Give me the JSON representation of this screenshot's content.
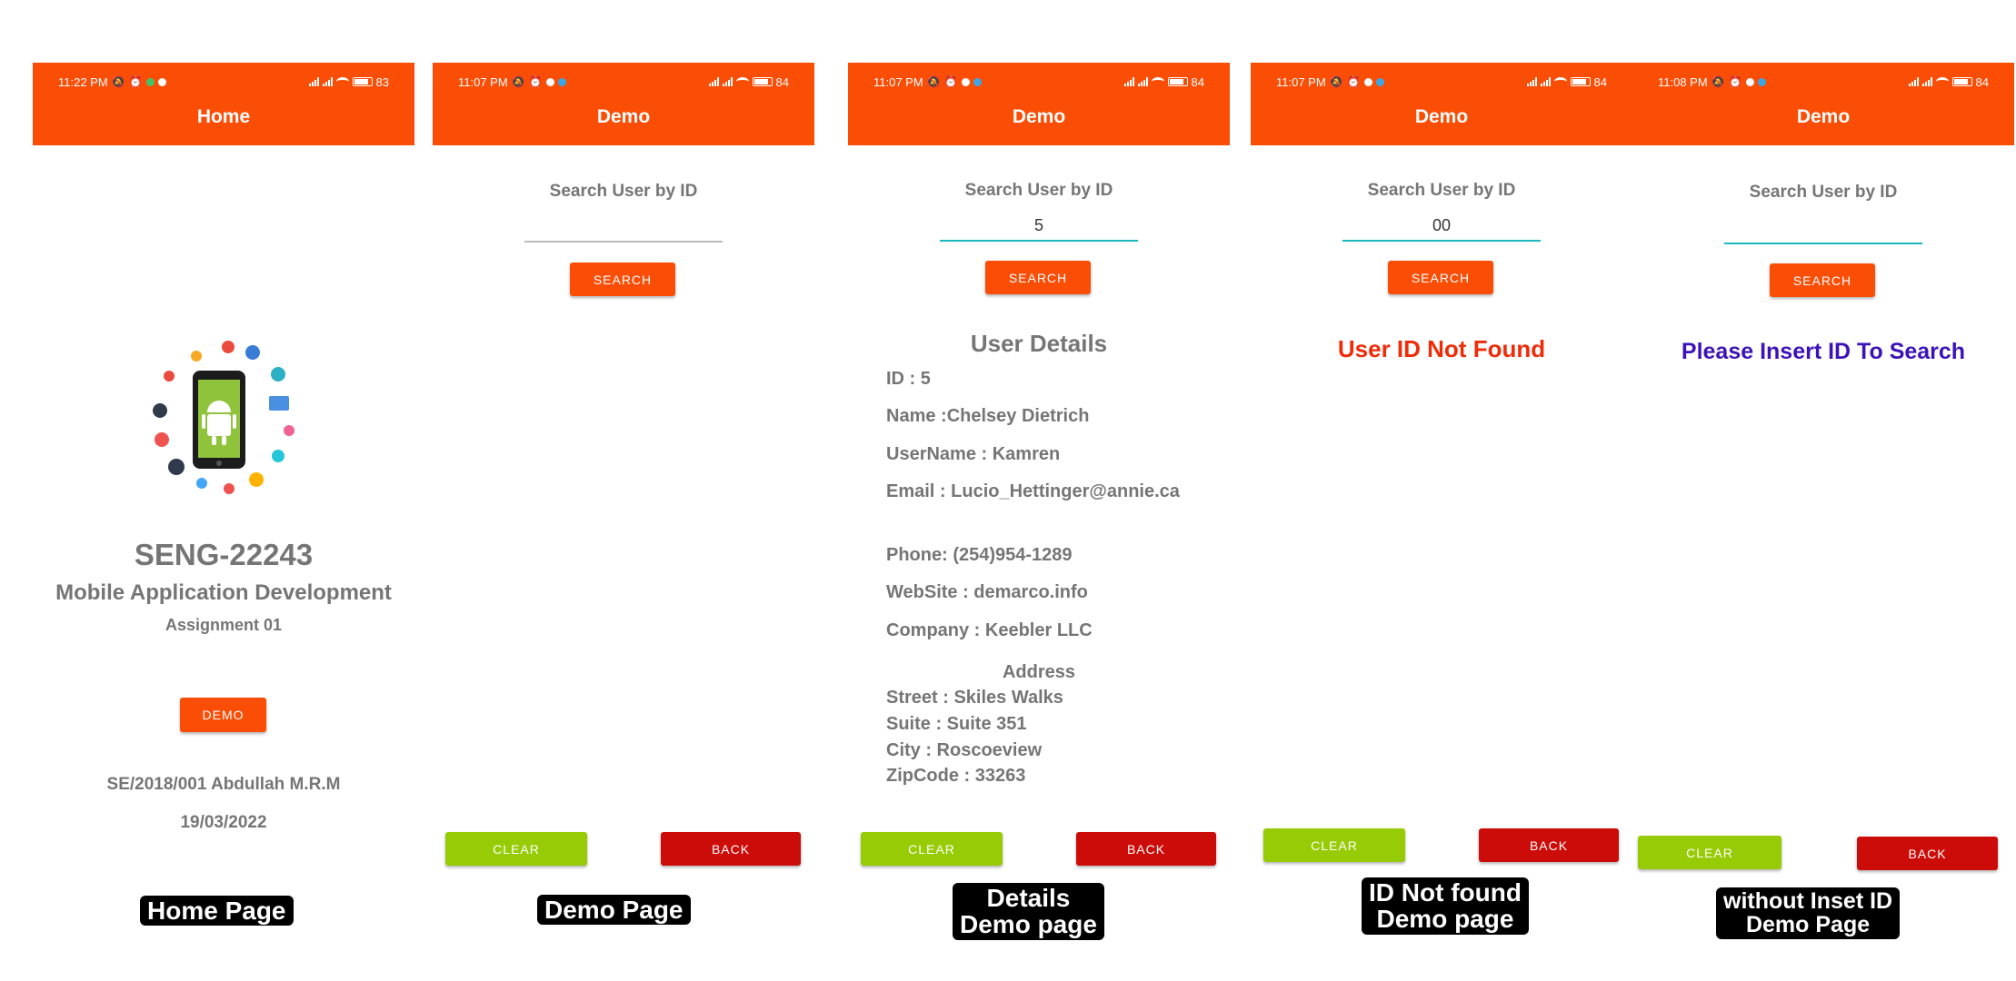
{
  "screens": [
    {
      "status_time": "11:22 PM",
      "battery": "83",
      "title": "Home",
      "course_code": "SENG-22243",
      "course_name": "Mobile Application Development",
      "assignment": "Assignment 01",
      "demo_button": "DEMO",
      "student": "SE/2018/001 Abdullah M.R.M",
      "date": "19/03/2022",
      "caption": "Home Page"
    },
    {
      "status_time": "11:07 PM",
      "battery": "84",
      "title": "Demo",
      "search_label": "Search User by ID",
      "input_value": "",
      "search_button": "SEARCH",
      "clear_button": "CLEAR",
      "back_button": "BACK",
      "caption": "Demo Page"
    },
    {
      "status_time": "11:07 PM",
      "battery": "84",
      "title": "Demo",
      "search_label": "Search User by ID",
      "input_value": "5",
      "search_button": "SEARCH",
      "details_heading": "User Details",
      "id": "ID : 5",
      "name": "Name :Chelsey Dietrich",
      "username": "UserName : Kamren",
      "email": "Email : Lucio_Hettinger@annie.ca",
      "phone": "Phone: (254)954-1289",
      "website": "WebSite : demarco.info",
      "company": "Company : Keebler LLC",
      "address_heading": "Address",
      "street": "Street : Skiles Walks",
      "suite": "Suite : Suite 351",
      "city": "City : Roscoeview",
      "zipcode": "ZipCode : 33263",
      "clear_button": "CLEAR",
      "back_button": "BACK",
      "caption_line1": "Details",
      "caption_line2": "Demo page"
    },
    {
      "status_time": "11:07 PM",
      "battery": "84",
      "title": "Demo",
      "search_label": "Search User by ID",
      "input_value": "00",
      "search_button": "SEARCH",
      "message": "User ID Not Found",
      "clear_button": "CLEAR",
      "back_button": "BACK",
      "caption_line1": "ID Not found",
      "caption_line2": "Demo page"
    },
    {
      "status_time": "11:08 PM",
      "battery": "84",
      "title": "Demo",
      "search_label": "Search User by ID",
      "input_value": "",
      "search_button": "SEARCH",
      "message": "Please Insert ID To Search",
      "clear_button": "CLEAR",
      "back_button": "BACK",
      "caption_line1": "without Inset ID",
      "caption_line2": "Demo Page"
    }
  ],
  "colors": {
    "appbar": "#fa4e07",
    "clear": "#96cb06",
    "back": "#cc0c08",
    "not_found": "#ef2b08",
    "insert_id": "#3d12b8"
  }
}
